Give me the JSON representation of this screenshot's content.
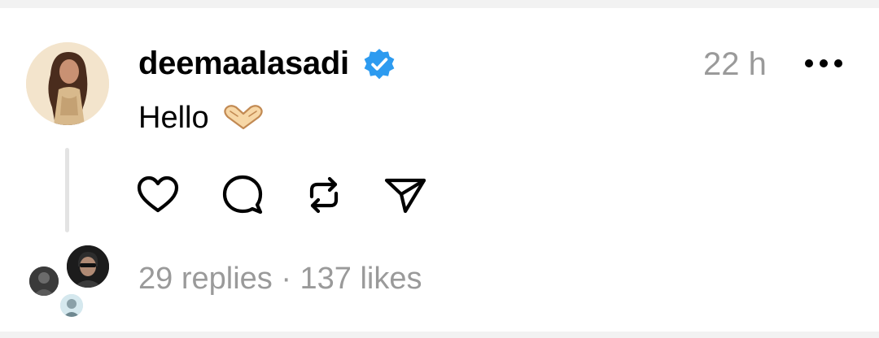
{
  "post": {
    "username": "deemaalasadi",
    "verified": true,
    "time": "22 h",
    "text": "Hello",
    "emoji": "heart-hands-emoji"
  },
  "actions": {
    "icons": [
      "heart-icon",
      "comment-icon",
      "repost-icon",
      "send-icon"
    ]
  },
  "footer": {
    "stats": "29 replies · 137 likes"
  },
  "colors": {
    "verified": "#2d9bf0",
    "muted": "#9a9a9a",
    "text": "#000000"
  }
}
